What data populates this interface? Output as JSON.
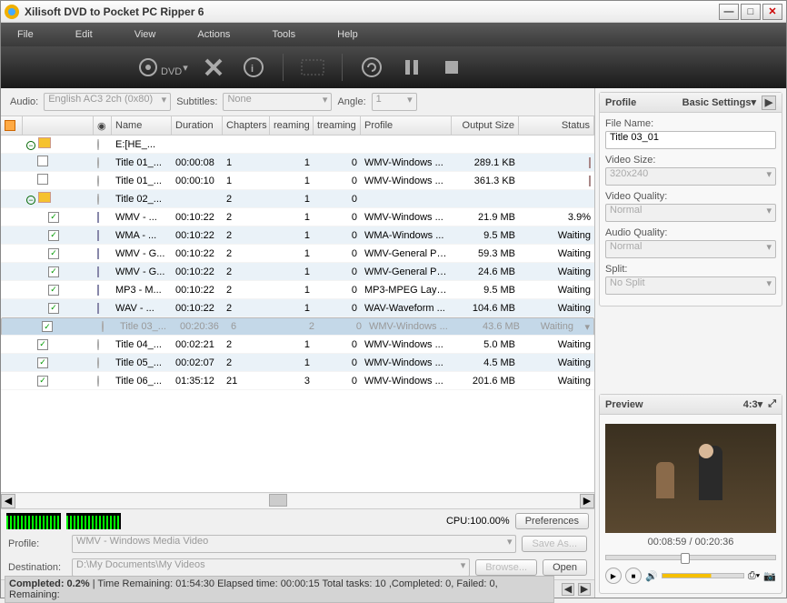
{
  "title": "Xilisoft DVD to Pocket PC Ripper 6",
  "menu": [
    "File",
    "Edit",
    "View",
    "Actions",
    "Tools",
    "Help"
  ],
  "selectors": {
    "audio_label": "Audio:",
    "audio": "English AC3 2ch (0x80)",
    "subtitles_label": "Subtitles:",
    "subtitles": "None",
    "angle_label": "Angle:",
    "angle": "1"
  },
  "columns": {
    "name": "Name",
    "duration": "Duration",
    "chapters": "Chapters",
    "reaming": "reaming",
    "treaming": "treaming",
    "profile": "Profile",
    "output": "Output Size",
    "status": "Status"
  },
  "rows": [
    {
      "lvl": 0,
      "exp": true,
      "chk": false,
      "icon": "disc",
      "name": "E:[HE_...",
      "dur": "",
      "chap": "",
      "ream": "",
      "tream": "",
      "prof": "",
      "out": "",
      "stat": ""
    },
    {
      "lvl": 1,
      "chk": false,
      "icon": "disc",
      "name": "Title 01_...",
      "dur": "00:00:08",
      "chap": "1",
      "ream": "1",
      "tream": "0",
      "prof": "WMV-Windows ...",
      "out": "289.1 KB",
      "stat": "clip",
      "alt": true
    },
    {
      "lvl": 1,
      "chk": false,
      "icon": "disc",
      "name": "Title 01_...",
      "dur": "00:00:10",
      "chap": "1",
      "ream": "1",
      "tream": "0",
      "prof": "WMV-Windows ...",
      "out": "361.3 KB",
      "stat": "clip"
    },
    {
      "lvl": 1,
      "exp": true,
      "icon": "disc",
      "name": "Title 02_...",
      "dur": "",
      "chap": "2",
      "ream": "1",
      "tream": "0",
      "prof": "",
      "out": "",
      "stat": "",
      "alt": true
    },
    {
      "lvl": 2,
      "chk": true,
      "icon": "file",
      "name": "WMV - ...",
      "dur": "00:10:22",
      "chap": "2",
      "ream": "1",
      "tream": "0",
      "prof": "WMV-Windows ...",
      "out": "21.9 MB",
      "stat": "3.9%"
    },
    {
      "lvl": 2,
      "chk": true,
      "icon": "file",
      "name": "WMA - ...",
      "dur": "00:10:22",
      "chap": "2",
      "ream": "1",
      "tream": "0",
      "prof": "WMA-Windows ...",
      "out": "9.5 MB",
      "stat": "Waiting",
      "alt": true
    },
    {
      "lvl": 2,
      "chk": true,
      "icon": "file",
      "name": "WMV - G...",
      "dur": "00:10:22",
      "chap": "2",
      "ream": "1",
      "tream": "0",
      "prof": "WMV-General Po...",
      "out": "59.3 MB",
      "stat": "Waiting"
    },
    {
      "lvl": 2,
      "chk": true,
      "icon": "file",
      "name": "WMV - G...",
      "dur": "00:10:22",
      "chap": "2",
      "ream": "1",
      "tream": "0",
      "prof": "WMV-General Po...",
      "out": "24.6 MB",
      "stat": "Waiting",
      "alt": true
    },
    {
      "lvl": 2,
      "chk": true,
      "icon": "file",
      "name": "MP3 - M...",
      "dur": "00:10:22",
      "chap": "2",
      "ream": "1",
      "tream": "0",
      "prof": "MP3-MPEG Layer...",
      "out": "9.5 MB",
      "stat": "Waiting"
    },
    {
      "lvl": 2,
      "chk": true,
      "icon": "file",
      "name": "WAV - ...",
      "dur": "00:10:22",
      "chap": "2",
      "ream": "1",
      "tream": "0",
      "prof": "WAV-Waveform ...",
      "out": "104.6 MB",
      "stat": "Waiting",
      "alt": true
    },
    {
      "lvl": 1,
      "chk": true,
      "icon": "disc",
      "name": "Title 03_...",
      "dur": "00:20:36",
      "chap": "6",
      "ream": "2",
      "tream": "0",
      "prof": "WMV-Windows ...",
      "out": "43.6 MB",
      "stat": "Waiting",
      "sel": true
    },
    {
      "lvl": 1,
      "chk": true,
      "icon": "disc",
      "name": "Title 04_...",
      "dur": "00:02:21",
      "chap": "2",
      "ream": "1",
      "tream": "0",
      "prof": "WMV-Windows ...",
      "out": "5.0 MB",
      "stat": "Waiting"
    },
    {
      "lvl": 1,
      "chk": true,
      "icon": "disc",
      "name": "Title 05_...",
      "dur": "00:02:07",
      "chap": "2",
      "ream": "1",
      "tream": "0",
      "prof": "WMV-Windows ...",
      "out": "4.5 MB",
      "stat": "Waiting",
      "alt": true
    },
    {
      "lvl": 1,
      "chk": true,
      "icon": "disc",
      "name": "Title 06_...",
      "dur": "01:35:12",
      "chap": "21",
      "ream": "3",
      "tream": "0",
      "prof": "WMV-Windows ...",
      "out": "201.6 MB",
      "stat": "Waiting"
    }
  ],
  "cpu": "CPU:100.00%",
  "prefs": "Preferences",
  "profile_row": {
    "label": "Profile:",
    "value": "WMV - Windows Media Video",
    "save": "Save As..."
  },
  "dest_row": {
    "label": "Destination:",
    "value": "D:\\My Documents\\My Videos",
    "browse": "Browse...",
    "open": "Open"
  },
  "status": {
    "completed": "Completed: 0.2%",
    "time": " | Time Remaining: 01:54:30 Elapsed time: 00:00:15 Total tasks: 10 ,Completed: 0, Failed: 0, Remaining:"
  },
  "profile_panel": {
    "title": "Profile",
    "basic": "Basic Settings",
    "filename_label": "File Name:",
    "filename": "Title 03_01",
    "videosize_label": "Video Size:",
    "videosize": "320x240",
    "videoquality_label": "Video Quality:",
    "videoquality": "Normal",
    "audioquality_label": "Audio Quality:",
    "audioquality": "Normal",
    "split_label": "Split:",
    "split": "No Split"
  },
  "preview": {
    "title": "Preview",
    "ratio": "4:3",
    "time": "00:08:59 / 00:20:36"
  }
}
